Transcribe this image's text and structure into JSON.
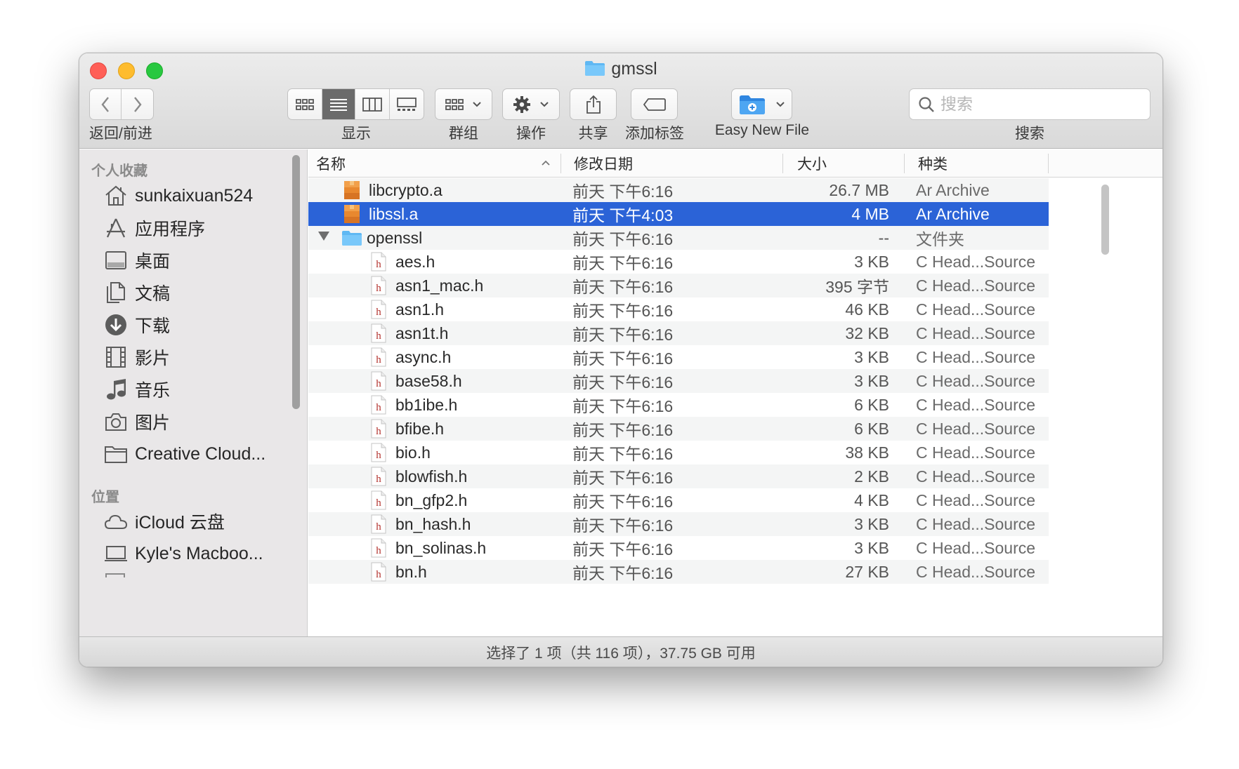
{
  "window": {
    "title": "gmssl"
  },
  "toolbar": {
    "nav_label": "返回/前进",
    "view_label": "显示",
    "group_label": "群组",
    "action_label": "操作",
    "share_label": "共享",
    "tags_label": "添加标签",
    "easy_new_file_label": "Easy New File",
    "search_label": "搜索",
    "search_placeholder": "搜索",
    "view_mode_active": "list"
  },
  "sidebar": {
    "favorites_header": "个人收藏",
    "favorites": [
      {
        "label": "sunkaixuan524",
        "icon": "home-icon"
      },
      {
        "label": "应用程序",
        "icon": "applications-icon"
      },
      {
        "label": "桌面",
        "icon": "desktop-icon"
      },
      {
        "label": "文稿",
        "icon": "documents-icon"
      },
      {
        "label": "下载",
        "icon": "downloads-icon"
      },
      {
        "label": "影片",
        "icon": "movies-icon"
      },
      {
        "label": "音乐",
        "icon": "music-icon"
      },
      {
        "label": "图片",
        "icon": "pictures-icon"
      },
      {
        "label": "Creative Cloud...",
        "icon": "folder-icon"
      }
    ],
    "locations_header": "位置",
    "locations": [
      {
        "label": "iCloud 云盘",
        "icon": "cloud-icon"
      },
      {
        "label": "Kyle's Macboo...",
        "icon": "laptop-icon"
      }
    ]
  },
  "columns": {
    "name": "名称",
    "date": "修改日期",
    "size": "大小",
    "kind": "种类"
  },
  "files": [
    {
      "name": "libcrypto.a",
      "date": "前天 下午6:16",
      "size": "26.7 MB",
      "kind": "Ar Archive",
      "type": "archive",
      "indent": 0
    },
    {
      "name": "libssl.a",
      "date": "前天 下午4:03",
      "size": "4 MB",
      "kind": "Ar Archive",
      "type": "archive",
      "indent": 0,
      "selected": true
    },
    {
      "name": "openssl",
      "date": "前天 下午6:16",
      "size": "--",
      "kind": "文件夹",
      "type": "folder",
      "indent": 0,
      "expanded": true
    },
    {
      "name": "aes.h",
      "date": "前天 下午6:16",
      "size": "3 KB",
      "kind": "C Head...Source",
      "type": "header",
      "indent": 1
    },
    {
      "name": "asn1_mac.h",
      "date": "前天 下午6:16",
      "size": "395 字节",
      "kind": "C Head...Source",
      "type": "header",
      "indent": 1
    },
    {
      "name": "asn1.h",
      "date": "前天 下午6:16",
      "size": "46 KB",
      "kind": "C Head...Source",
      "type": "header",
      "indent": 1
    },
    {
      "name": "asn1t.h",
      "date": "前天 下午6:16",
      "size": "32 KB",
      "kind": "C Head...Source",
      "type": "header",
      "indent": 1
    },
    {
      "name": "async.h",
      "date": "前天 下午6:16",
      "size": "3 KB",
      "kind": "C Head...Source",
      "type": "header",
      "indent": 1
    },
    {
      "name": "base58.h",
      "date": "前天 下午6:16",
      "size": "3 KB",
      "kind": "C Head...Source",
      "type": "header",
      "indent": 1
    },
    {
      "name": "bb1ibe.h",
      "date": "前天 下午6:16",
      "size": "6 KB",
      "kind": "C Head...Source",
      "type": "header",
      "indent": 1
    },
    {
      "name": "bfibe.h",
      "date": "前天 下午6:16",
      "size": "6 KB",
      "kind": "C Head...Source",
      "type": "header",
      "indent": 1
    },
    {
      "name": "bio.h",
      "date": "前天 下午6:16",
      "size": "38 KB",
      "kind": "C Head...Source",
      "type": "header",
      "indent": 1
    },
    {
      "name": "blowfish.h",
      "date": "前天 下午6:16",
      "size": "2 KB",
      "kind": "C Head...Source",
      "type": "header",
      "indent": 1
    },
    {
      "name": "bn_gfp2.h",
      "date": "前天 下午6:16",
      "size": "4 KB",
      "kind": "C Head...Source",
      "type": "header",
      "indent": 1
    },
    {
      "name": "bn_hash.h",
      "date": "前天 下午6:16",
      "size": "3 KB",
      "kind": "C Head...Source",
      "type": "header",
      "indent": 1
    },
    {
      "name": "bn_solinas.h",
      "date": "前天 下午6:16",
      "size": "3 KB",
      "kind": "C Head...Source",
      "type": "header",
      "indent": 1
    },
    {
      "name": "bn.h",
      "date": "前天 下午6:16",
      "size": "27 KB",
      "kind": "C Head...Source",
      "type": "header",
      "indent": 1
    }
  ],
  "status": {
    "text": "选择了 1 项（共 116 项），37.75 GB 可用"
  },
  "colors": {
    "selection": "#2b63d7",
    "close": "#ff5f57",
    "minimize": "#febc2e",
    "maximize": "#28c840",
    "folder": "#5fb8f3"
  }
}
